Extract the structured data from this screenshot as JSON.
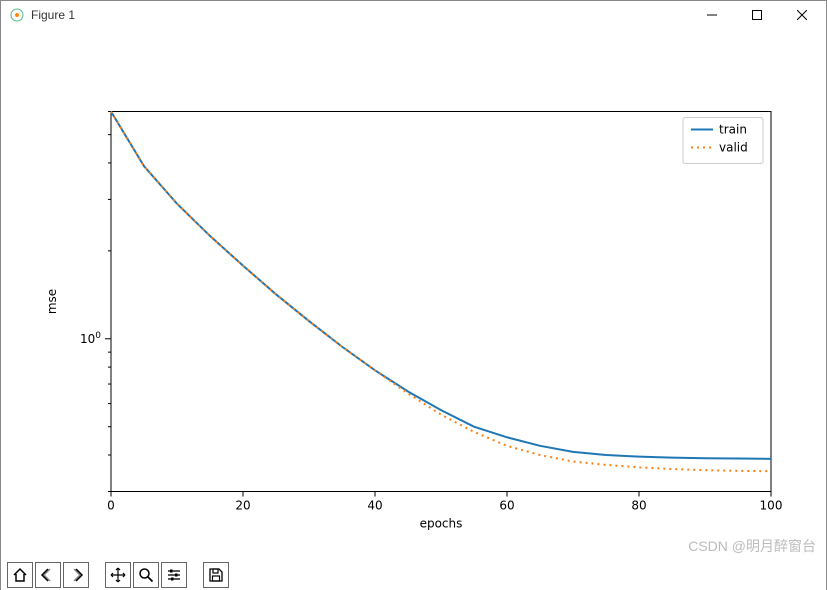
{
  "window": {
    "title": "Figure 1"
  },
  "legend": {
    "items": [
      "train",
      "valid"
    ]
  },
  "axes": {
    "xlabel": "epochs",
    "ylabel": "mse"
  },
  "ticks": {
    "x": [
      0,
      20,
      40,
      60,
      80,
      100
    ],
    "y_major_label": "10",
    "y_major_exp": "0"
  },
  "colors": {
    "train": "#1f77b4",
    "valid": "#ff7f0e"
  },
  "watermark": "CSDN @明月醉窗台",
  "chart_data": {
    "type": "line",
    "xlabel": "epochs",
    "ylabel": "mse",
    "xlim": [
      0,
      100
    ],
    "ylim": [
      0.3,
      6.0
    ],
    "yscale": "log",
    "legend_position": "upper right",
    "grid": false,
    "series": [
      {
        "name": "train",
        "style": "solid",
        "color": "#1f77b4",
        "x": [
          0,
          5,
          10,
          15,
          20,
          25,
          30,
          35,
          40,
          45,
          50,
          55,
          60,
          65,
          70,
          75,
          80,
          85,
          90,
          95,
          100
        ],
        "y": [
          6.0,
          3.9,
          2.9,
          2.25,
          1.78,
          1.42,
          1.15,
          0.94,
          0.78,
          0.66,
          0.57,
          0.5,
          0.46,
          0.43,
          0.41,
          0.4,
          0.395,
          0.392,
          0.39,
          0.389,
          0.388
        ]
      },
      {
        "name": "valid",
        "style": "dotted",
        "color": "#ff7f0e",
        "x": [
          0,
          5,
          10,
          15,
          20,
          25,
          30,
          35,
          40,
          45,
          50,
          55,
          60,
          65,
          70,
          75,
          80,
          85,
          90,
          95,
          100
        ],
        "y": [
          6.0,
          3.9,
          2.9,
          2.25,
          1.78,
          1.42,
          1.15,
          0.94,
          0.78,
          0.65,
          0.55,
          0.48,
          0.43,
          0.4,
          0.38,
          0.37,
          0.363,
          0.358,
          0.355,
          0.353,
          0.352
        ]
      }
    ]
  }
}
